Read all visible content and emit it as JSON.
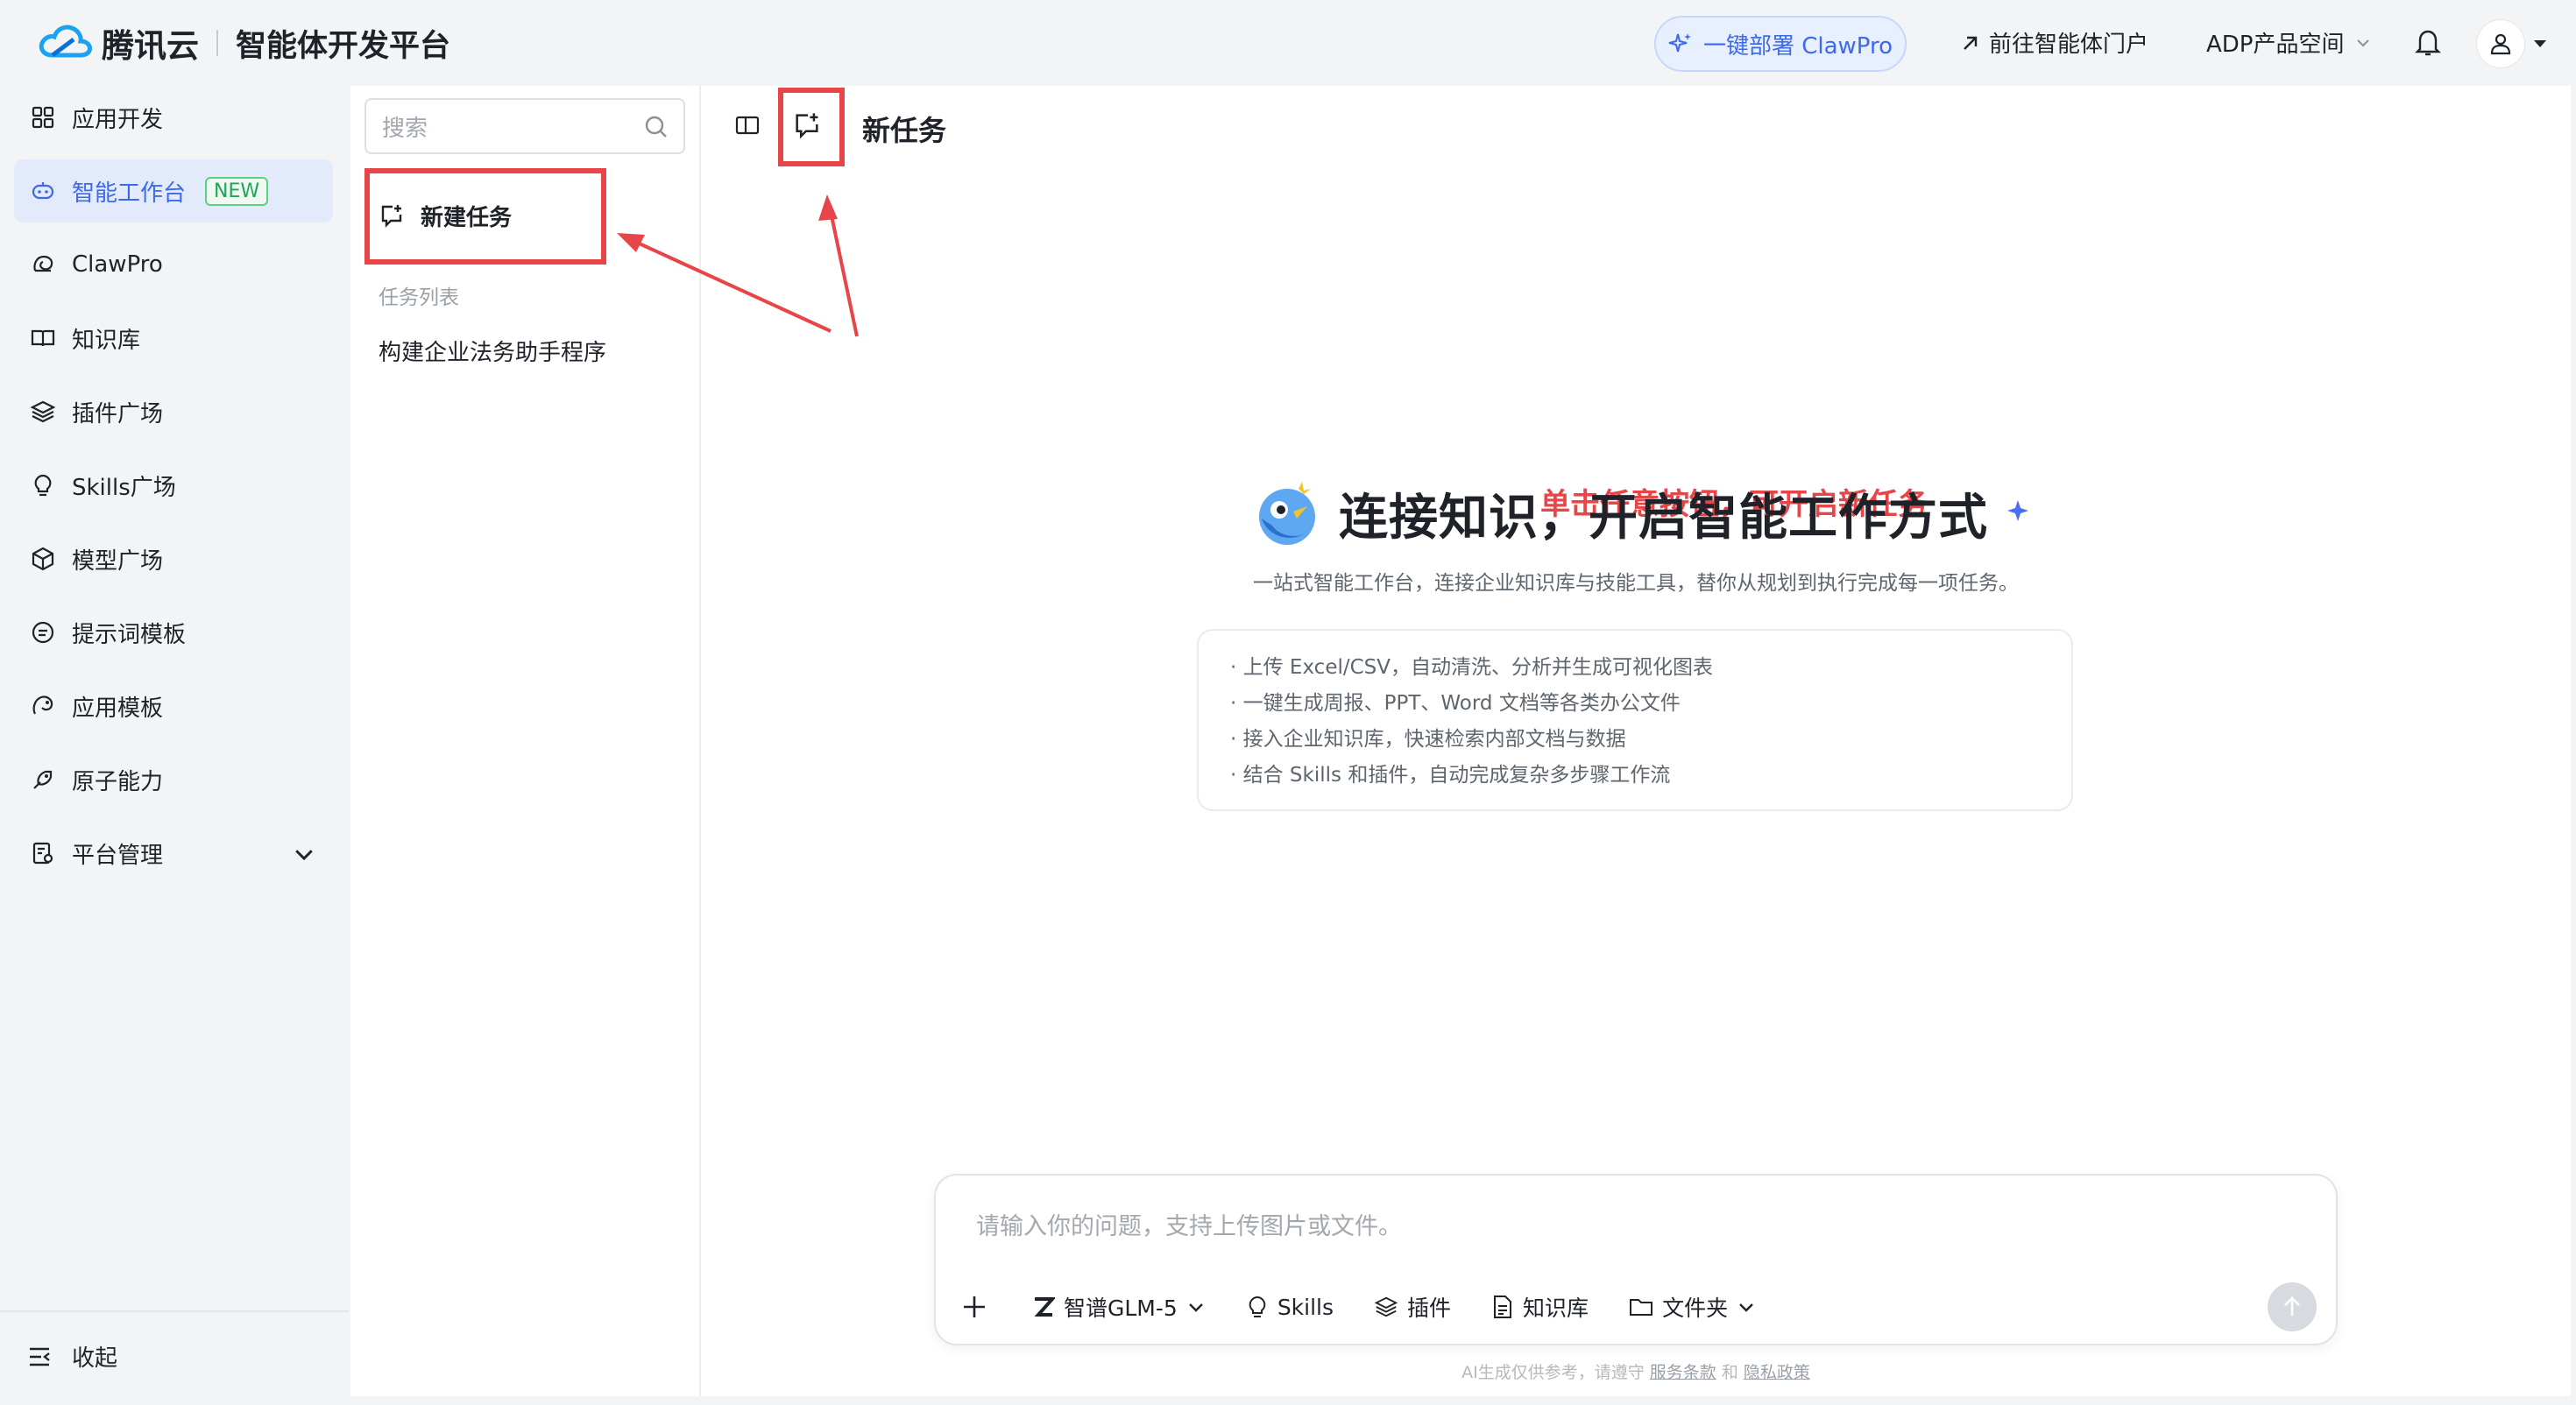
{
  "header": {
    "brand": "腾讯云",
    "platform_title": "智能体开发平台",
    "deploy_button": "一键部署 ClawPro",
    "portal_link": "前往智能体门户",
    "product_space": "ADP产品空间"
  },
  "sidebar": {
    "items": [
      {
        "label": "应用开发",
        "icon": "grid-icon"
      },
      {
        "label": "智能工作台",
        "icon": "robot-icon",
        "badge": "NEW",
        "active": true
      },
      {
        "label": "ClawPro",
        "icon": "claw-icon"
      },
      {
        "label": "知识库",
        "icon": "book-icon"
      },
      {
        "label": "插件广场",
        "icon": "layers-icon"
      },
      {
        "label": "Skills广场",
        "icon": "bulb-icon"
      },
      {
        "label": "模型广场",
        "icon": "cube-icon"
      },
      {
        "label": "提示词模板",
        "icon": "message-icon"
      },
      {
        "label": "应用模板",
        "icon": "template-icon"
      },
      {
        "label": "原子能力",
        "icon": "atom-icon"
      },
      {
        "label": "平台管理",
        "icon": "manage-icon"
      }
    ],
    "collapse_label": "收起"
  },
  "task_panel": {
    "search_placeholder": "搜索",
    "new_task_label": "新建任务",
    "task_list_label": "任务列表",
    "tasks": [
      "构建企业法务助手程序"
    ]
  },
  "main": {
    "title": "新任务",
    "annotation": "单击任意按钮，可开启新任务",
    "hero_title": "连接知识，开启智能工作方式",
    "hero_subtitle": "一站式智能工作台，连接企业知识库与技能工具，替你从规划到执行完成每一项任务。",
    "features": [
      "· 上传 Excel/CSV，自动清洗、分析并生成可视化图表",
      "· 一键生成周报、PPT、Word 文档等各类办公文件",
      "· 接入企业知识库，快速检索内部文档与数据",
      "· 结合 Skills 和插件，自动完成复杂多步骤工作流"
    ]
  },
  "composer": {
    "placeholder": "请输入你的问题，支持上传图片或文件。",
    "model": "智谱GLM-5",
    "skills": "Skills",
    "plugins": "插件",
    "knowledge": "知识库",
    "folder": "文件夹"
  },
  "footer": {
    "disclaimer_prefix": "AI生成仅供参考，请遵守",
    "terms": "服务条款",
    "and": "和",
    "privacy": "隐私政策"
  },
  "colors": {
    "accent": "#3d6ae8",
    "annotation": "#e84548",
    "badge_green": "#22a456"
  }
}
